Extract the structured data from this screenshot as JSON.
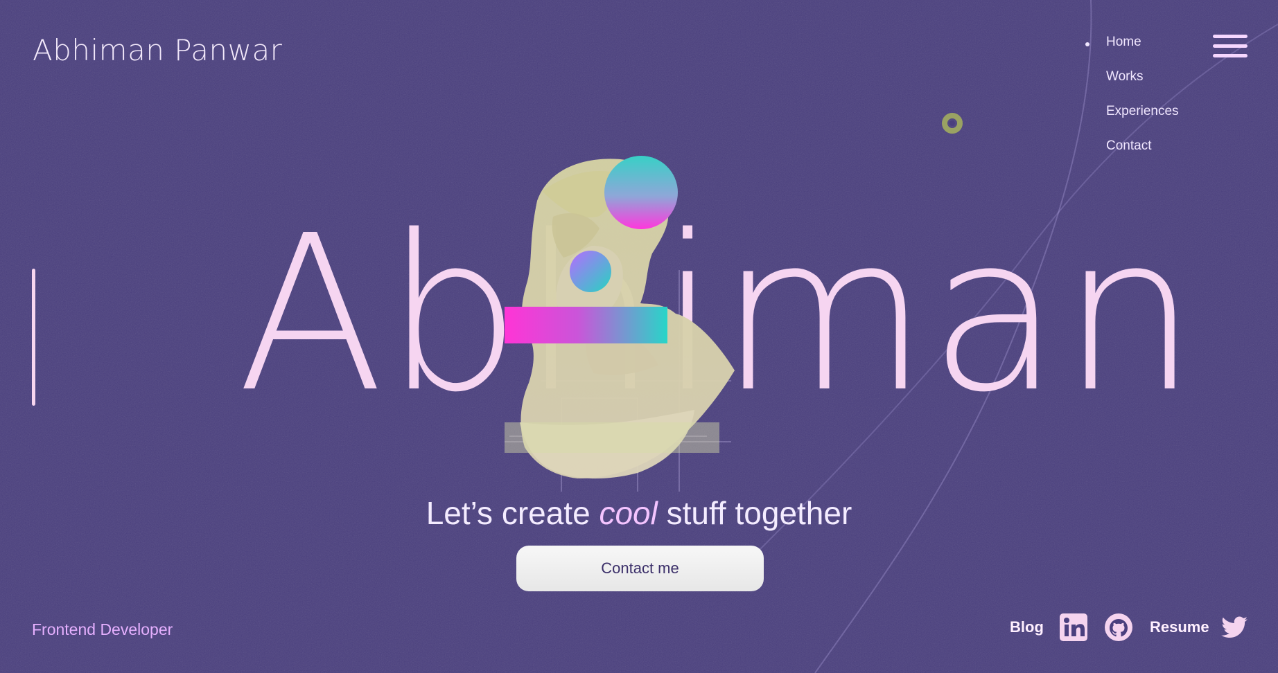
{
  "header": {
    "brand": "Abhiman Panwar",
    "menu_icon": "hamburger-icon"
  },
  "nav": {
    "items": [
      {
        "label": "Home",
        "active": true
      },
      {
        "label": "Works"
      },
      {
        "label": "Experiences"
      },
      {
        "label": "Contact"
      }
    ]
  },
  "hero": {
    "word": "Abhiman",
    "tagline_prefix": "Let’s create ",
    "tagline_emphasis": "cool",
    "tagline_suffix": " stuff together",
    "cta": "Contact me"
  },
  "footer": {
    "role": "Frontend Developer",
    "links": [
      "Blog",
      "Resume"
    ],
    "icons": [
      "linkedin-icon",
      "github-icon",
      "twitter-icon"
    ]
  },
  "colors": {
    "background": "#4a3f7e",
    "text": "#f6d5f1",
    "accent": "#e6b0ff",
    "button_bg": "#efefef",
    "button_text": "#3b2f69"
  }
}
